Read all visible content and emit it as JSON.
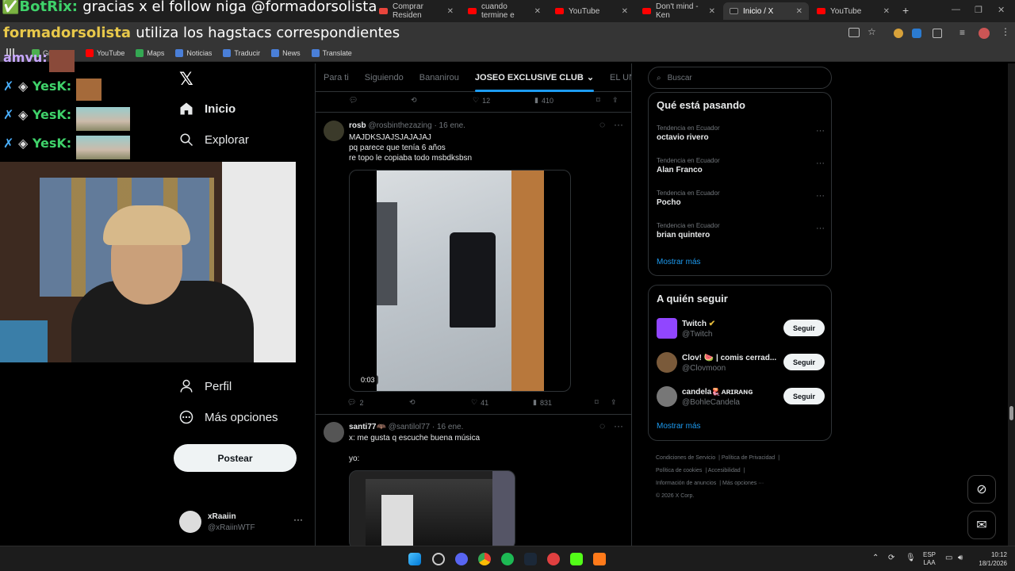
{
  "chat_overlay": {
    "line1_user": "BotRix:",
    "line1_text": "gracias x el follow niga @formadorsolista",
    "line2_user": "formadorsolista",
    "line2_text": "utiliza los hagstacs correspondientes",
    "line3_user": "amvu:",
    "line4_user": "YesK:",
    "line5_user": "YesK:",
    "line6_user": "YesK:"
  },
  "browser": {
    "tabs": [
      {
        "label": "Comprar Residen"
      },
      {
        "label": "cuando termine e"
      },
      {
        "label": "YouTube"
      },
      {
        "label": "Don't mind - Ken"
      },
      {
        "label": "Inicio / X"
      },
      {
        "label": "YouTube"
      }
    ],
    "bookmarks": [
      "YouTube",
      "Maps",
      "Noticias",
      "Traducir",
      "News",
      "Translate"
    ],
    "bookmark_partial": "Gr"
  },
  "x_nav": {
    "items": [
      {
        "label": "Inicio"
      },
      {
        "label": "Explorar"
      },
      {
        "label": "Perfil"
      },
      {
        "label": "Más opciones"
      }
    ],
    "post_button": "Postear",
    "account": {
      "name": "xRaaiin",
      "handle": "@xRaiinWTF"
    }
  },
  "feed": {
    "tabs": [
      "Para ti",
      "Siguiendo",
      "Bananirou",
      "JOSEO EXCLUSIVE CLUB",
      "EL UNDER"
    ],
    "top_actions": {
      "likes": "12",
      "views": "410"
    },
    "tweets": [
      {
        "name": "rosb",
        "handle": "@rosbinthezazing",
        "date": "· 16 ene.",
        "text": "MAJDKSJAJSJAJAJAJ\npq parece que tenía 6 años\nre topo le copiaba todo msbdksbsn",
        "video_duration": "0:03",
        "replies": "2",
        "likes": "41",
        "views": "831"
      },
      {
        "name": "santi77🦇",
        "handle": "@santilol77",
        "date": "· 16 ene.",
        "text": "x: me gusta q escuche buena música\n\nyo:"
      }
    ]
  },
  "right": {
    "search_placeholder": "Buscar",
    "trends_title": "Qué está pasando",
    "trends": [
      {
        "context": "Tendencia en Ecuador",
        "name": "octavio rivero"
      },
      {
        "context": "Tendencia en Ecuador",
        "name": "Alan Franco"
      },
      {
        "context": "Tendencia en Ecuador",
        "name": "Pocho"
      },
      {
        "context": "Tendencia en Ecuador",
        "name": "brian quintero"
      }
    ],
    "trends_more": "Mostrar más",
    "who_title": "A quién seguir",
    "who": [
      {
        "name": "Twitch",
        "handle": "@Twitch",
        "button": "Seguir"
      },
      {
        "name": "Clov! 🍉 | comis cerrad...",
        "handle": "@Clovmoon",
        "button": "Seguir"
      },
      {
        "name": "candela🪼ᴀʀɪʀᴀɴɢ",
        "handle": "@BohleCandela",
        "button": "Seguir"
      }
    ],
    "who_more": "Mostrar más",
    "footer": [
      "Condiciones de Servicio",
      "Política de Privacidad",
      "Política de cookies",
      "Accesibilidad",
      "Información de anuncios",
      "Más opciones ···",
      "© 2026 X Corp."
    ]
  },
  "taskbar": {
    "lang1": "ESP",
    "lang2": "LAA",
    "time": "10:12",
    "date": "18/1/2026"
  }
}
